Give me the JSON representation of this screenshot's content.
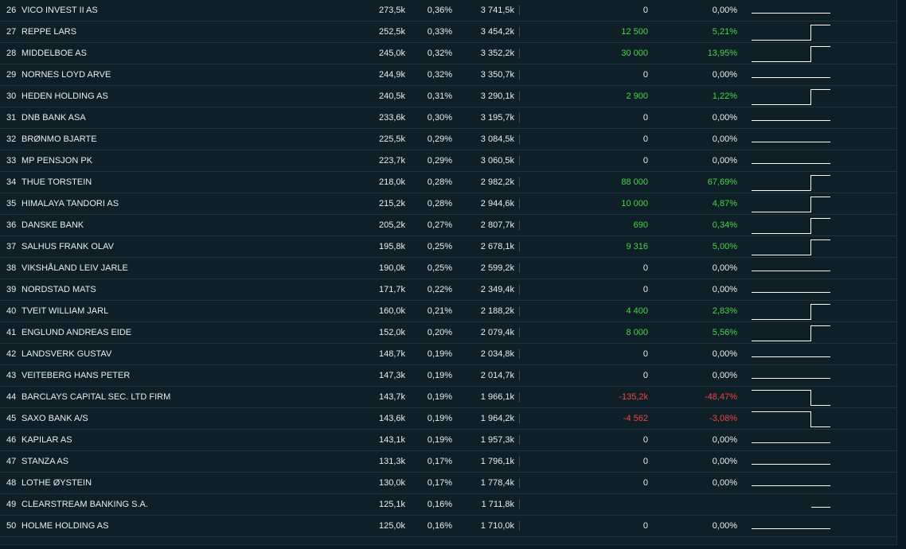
{
  "colors": {
    "positive": "#48d64b",
    "negative": "#ef4545",
    "text": "#e6eef2",
    "sparkline": "#ffffff"
  },
  "rows": [
    {
      "rank": "26",
      "name": "VICO INVEST II AS",
      "shares": "273,5k",
      "pct": "0,36%",
      "value": "3 741,5k",
      "change": "0",
      "change_pct": "0,00%",
      "trend": "flat"
    },
    {
      "rank": "27",
      "name": "REPPE LARS",
      "shares": "252,5k",
      "pct": "0,33%",
      "value": "3 454,2k",
      "change": "12 500",
      "change_pct": "5,21%",
      "trend": "up"
    },
    {
      "rank": "28",
      "name": "MIDDELBOE AS",
      "shares": "245,0k",
      "pct": "0,32%",
      "value": "3 352,2k",
      "change": "30 000",
      "change_pct": "13,95%",
      "trend": "up"
    },
    {
      "rank": "29",
      "name": "NORNES LOYD ARVE",
      "shares": "244,9k",
      "pct": "0,32%",
      "value": "3 350,7k",
      "change": "0",
      "change_pct": "0,00%",
      "trend": "flat"
    },
    {
      "rank": "30",
      "name": "HEDEN HOLDING AS",
      "shares": "240,5k",
      "pct": "0,31%",
      "value": "3 290,1k",
      "change": "2 900",
      "change_pct": "1,22%",
      "trend": "up"
    },
    {
      "rank": "31",
      "name": "DNB BANK ASA",
      "shares": "233,6k",
      "pct": "0,30%",
      "value": "3 195,7k",
      "change": "0",
      "change_pct": "0,00%",
      "trend": "flat"
    },
    {
      "rank": "32",
      "name": "BRØNMO BJARTE",
      "shares": "225,5k",
      "pct": "0,29%",
      "value": "3 084,5k",
      "change": "0",
      "change_pct": "0,00%",
      "trend": "flat"
    },
    {
      "rank": "33",
      "name": "MP PENSJON PK",
      "shares": "223,7k",
      "pct": "0,29%",
      "value": "3 060,5k",
      "change": "0",
      "change_pct": "0,00%",
      "trend": "flat"
    },
    {
      "rank": "34",
      "name": "THUE TORSTEIN",
      "shares": "218,0k",
      "pct": "0,28%",
      "value": "2 982,2k",
      "change": "88 000",
      "change_pct": "67,69%",
      "trend": "up"
    },
    {
      "rank": "35",
      "name": "HIMALAYA TANDORI AS",
      "shares": "215,2k",
      "pct": "0,28%",
      "value": "2 944,6k",
      "change": "10 000",
      "change_pct": "4,87%",
      "trend": "up"
    },
    {
      "rank": "36",
      "name": "DANSKE BANK",
      "shares": "205,2k",
      "pct": "0,27%",
      "value": "2 807,7k",
      "change": "690",
      "change_pct": "0,34%",
      "trend": "up"
    },
    {
      "rank": "37",
      "name": "SALHUS FRANK OLAV",
      "shares": "195,8k",
      "pct": "0,25%",
      "value": "2 678,1k",
      "change": "9 316",
      "change_pct": "5,00%",
      "trend": "up"
    },
    {
      "rank": "38",
      "name": "VIKSHÅLAND LEIV JARLE",
      "shares": "190,0k",
      "pct": "0,25%",
      "value": "2 599,2k",
      "change": "0",
      "change_pct": "0,00%",
      "trend": "flat"
    },
    {
      "rank": "39",
      "name": "NORDSTAD MATS",
      "shares": "171,7k",
      "pct": "0,22%",
      "value": "2 349,4k",
      "change": "0",
      "change_pct": "0,00%",
      "trend": "flat"
    },
    {
      "rank": "40",
      "name": "TVEIT WILLIAM JARL",
      "shares": "160,0k",
      "pct": "0,21%",
      "value": "2 188,2k",
      "change": "4 400",
      "change_pct": "2,83%",
      "trend": "up"
    },
    {
      "rank": "41",
      "name": "ENGLUND ANDREAS EIDE",
      "shares": "152,0k",
      "pct": "0,20%",
      "value": "2 079,4k",
      "change": "8 000",
      "change_pct": "5,56%",
      "trend": "up"
    },
    {
      "rank": "42",
      "name": "LANDSVERK GUSTAV",
      "shares": "148,7k",
      "pct": "0,19%",
      "value": "2 034,8k",
      "change": "0",
      "change_pct": "0,00%",
      "trend": "flat"
    },
    {
      "rank": "43",
      "name": "VEITEBERG HANS PETER",
      "shares": "147,3k",
      "pct": "0,19%",
      "value": "2 014,7k",
      "change": "0",
      "change_pct": "0,00%",
      "trend": "flat"
    },
    {
      "rank": "44",
      "name": "BARCLAYS CAPITAL SEC. LTD FIRM",
      "shares": "143,7k",
      "pct": "0,19%",
      "value": "1 966,1k",
      "change": "-135,2k",
      "change_pct": "-48,47%",
      "trend": "down"
    },
    {
      "rank": "45",
      "name": "SAXO BANK A/S",
      "shares": "143,6k",
      "pct": "0,19%",
      "value": "1 964,2k",
      "change": "-4 562",
      "change_pct": "-3,08%",
      "trend": "down"
    },
    {
      "rank": "46",
      "name": "KAPILAR AS",
      "shares": "143,1k",
      "pct": "0,19%",
      "value": "1 957,3k",
      "change": "0",
      "change_pct": "0,00%",
      "trend": "flat"
    },
    {
      "rank": "47",
      "name": "STANZA AS",
      "shares": "131,3k",
      "pct": "0,17%",
      "value": "1 796,1k",
      "change": "0",
      "change_pct": "0,00%",
      "trend": "flat"
    },
    {
      "rank": "48",
      "name": "LOTHE ØYSTEIN",
      "shares": "130,0k",
      "pct": "0,17%",
      "value": "1 778,4k",
      "change": "0",
      "change_pct": "0,00%",
      "trend": "flat"
    },
    {
      "rank": "49",
      "name": "CLEARSTREAM BANKING S.A.",
      "shares": "125,1k",
      "pct": "0,16%",
      "value": "1 711,8k",
      "change": "",
      "change_pct": "",
      "trend": "new"
    },
    {
      "rank": "50",
      "name": "HOLME HOLDING AS",
      "shares": "125,0k",
      "pct": "0,16%",
      "value": "1 710,0k",
      "change": "0",
      "change_pct": "0,00%",
      "trend": "flat"
    }
  ]
}
